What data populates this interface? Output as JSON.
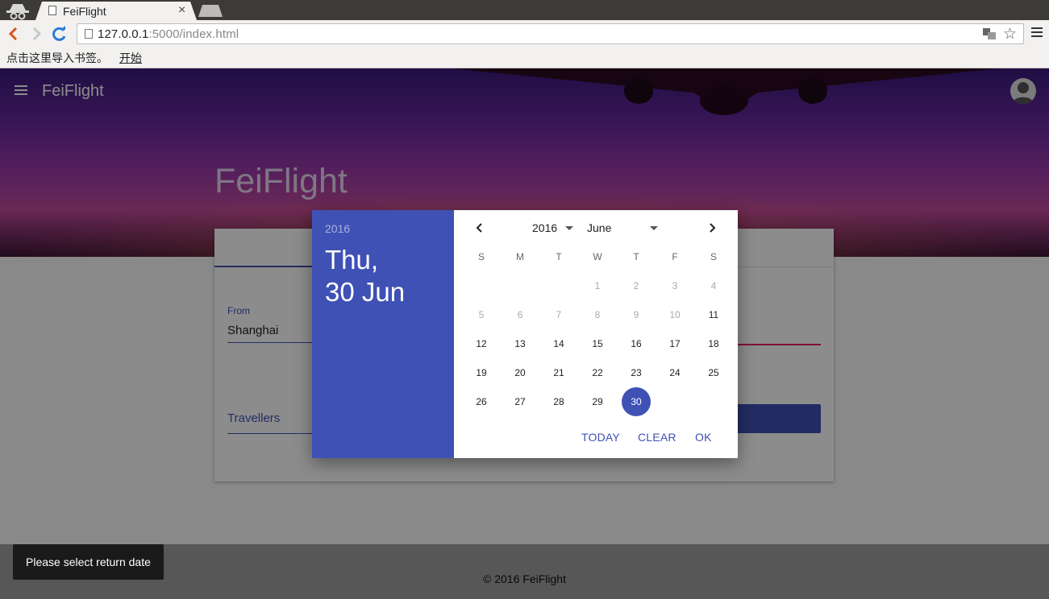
{
  "browser": {
    "tab_title": "FeiFlight",
    "tab_close": "×",
    "url_host": "127.0.0.1",
    "url_rest": ":5000/index.html",
    "bookmark_prompt": "点击这里导入书签。",
    "bookmark_link": "开始"
  },
  "app": {
    "name": "FeiFlight",
    "hero_title": "FeiFlight",
    "footer": "© 2016 FeiFlight"
  },
  "form": {
    "from_label": "From",
    "from_value": "Shanghai",
    "travellers_label": "Travellers"
  },
  "snackbar": {
    "message": "Please select return date"
  },
  "datepicker": {
    "header_year": "2016",
    "header_weekday": "Thu,",
    "header_date": "30 Jun",
    "year": "2016",
    "month": "June",
    "weekday_labels": [
      "S",
      "M",
      "T",
      "W",
      "T",
      "F",
      "S"
    ],
    "first_weekday_index": 3,
    "days_in_month": 30,
    "disabled_through": 10,
    "selected_day": 30,
    "actions": {
      "today": "TODAY",
      "clear": "CLEAR",
      "ok": "OK"
    }
  },
  "colors": {
    "primary": "#3f51b5",
    "accent": "#e91e63"
  }
}
